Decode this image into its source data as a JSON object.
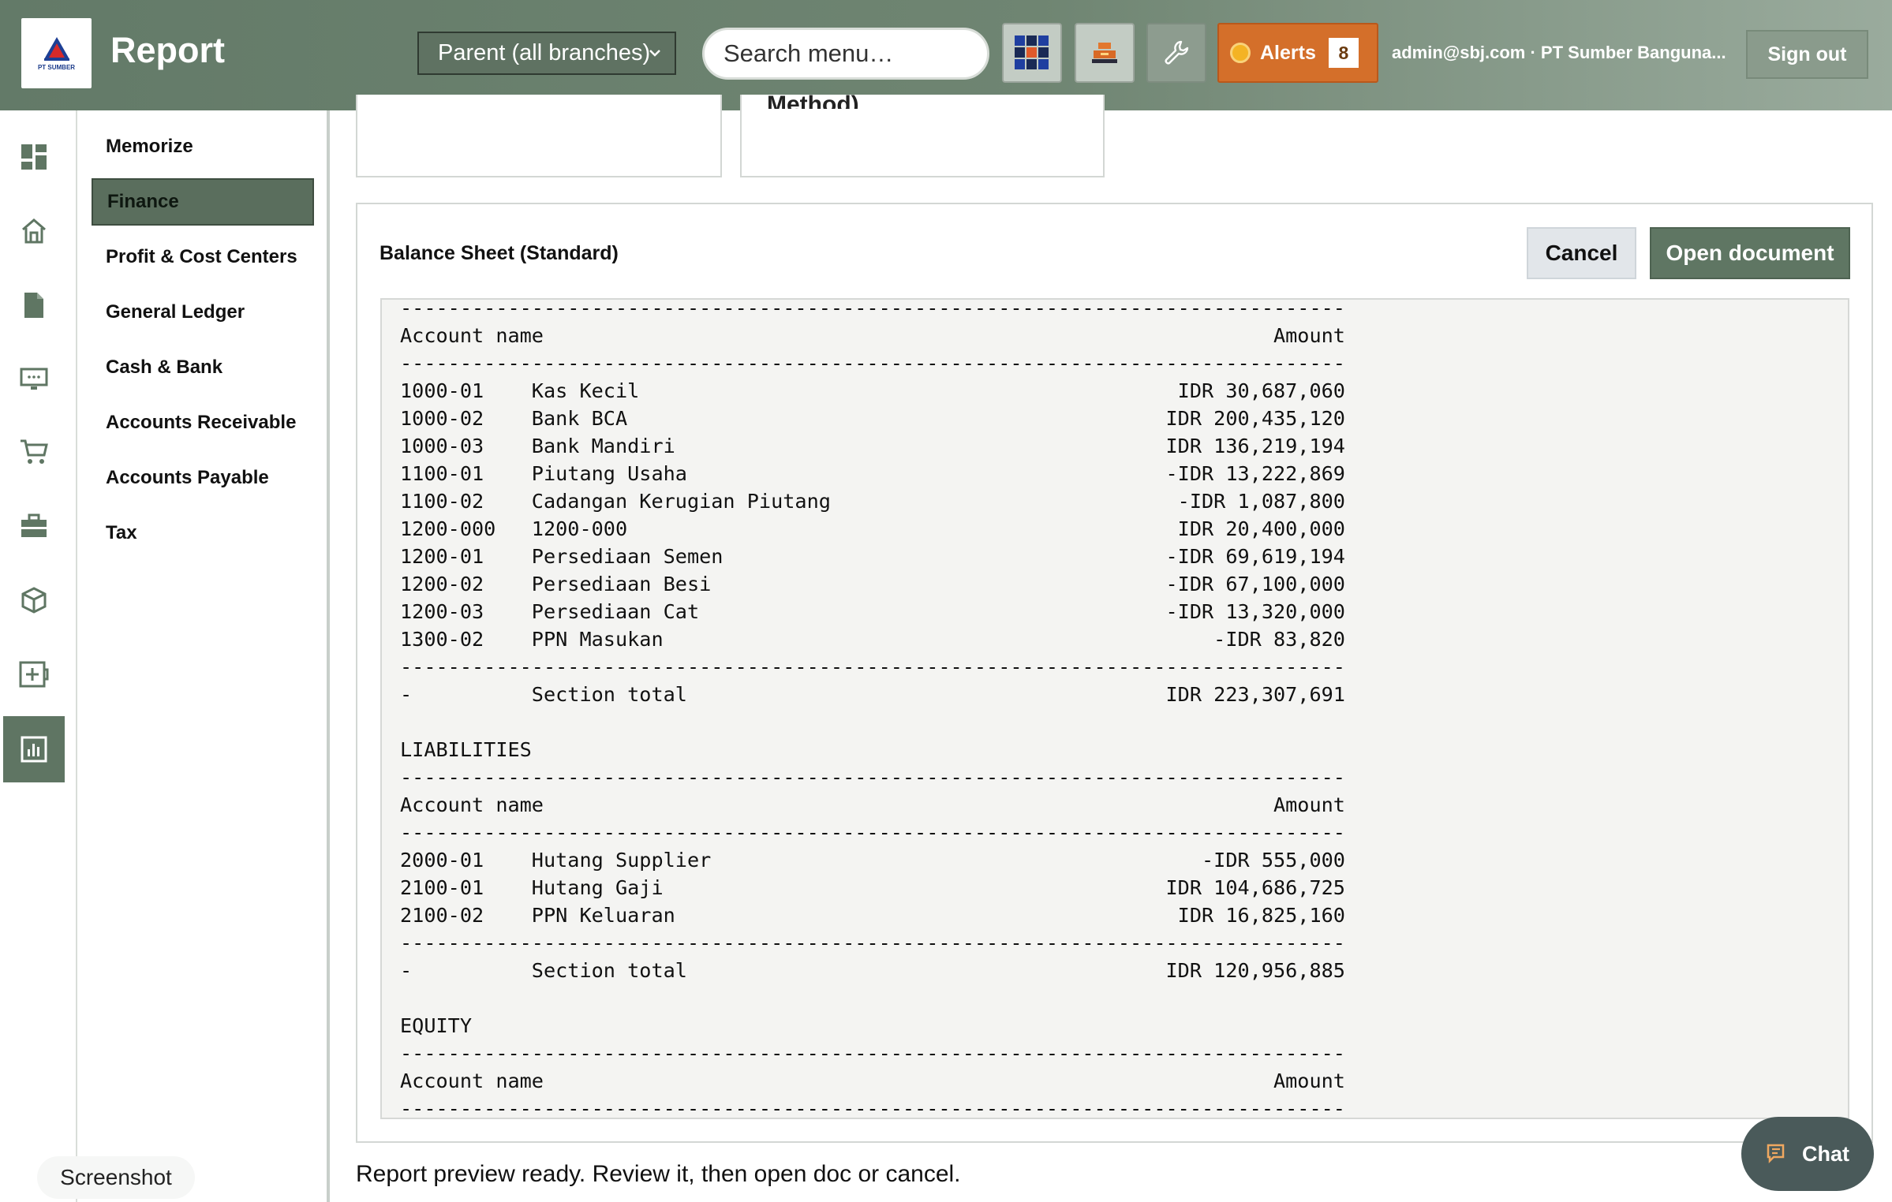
{
  "header": {
    "logo_text": "PT SUMBER",
    "title": "Report",
    "branch_select": "Parent (all branches)",
    "search_placeholder": "Search menu…",
    "alerts_label": "Alerts",
    "alerts_count": "8",
    "user": "admin@sbj.com · PT Sumber Banguna...",
    "sign_out": "Sign out"
  },
  "rail": {
    "icons": [
      "dashboard-icon",
      "home-icon",
      "document-icon",
      "monitor-icon",
      "cart-icon",
      "briefcase-icon",
      "box-icon",
      "add-box-icon",
      "report-icon"
    ],
    "active": "report-icon"
  },
  "subnav": {
    "items": [
      {
        "label": "Memorize"
      },
      {
        "label": "Finance"
      },
      {
        "label": "Profit & Cost Centers"
      },
      {
        "label": "General Ledger"
      },
      {
        "label": "Cash & Bank"
      },
      {
        "label": "Accounts Receivable"
      },
      {
        "label": "Accounts Payable"
      },
      {
        "label": "Tax"
      }
    ],
    "active": "Finance"
  },
  "cards_top": [
    {
      "text": ""
    },
    {
      "text": "Method)"
    }
  ],
  "panel": {
    "title": "Balance Sheet (Standard)",
    "cancel_label": "Cancel",
    "open_label": "Open document"
  },
  "report": {
    "col_account": "Account name",
    "col_amount": "Amount",
    "assets": [
      {
        "code": "1000-01",
        "name": "Kas Kecil",
        "amount": "IDR 30,687,060"
      },
      {
        "code": "1000-02",
        "name": "Bank BCA",
        "amount": "IDR 200,435,120"
      },
      {
        "code": "1000-03",
        "name": "Bank Mandiri",
        "amount": "IDR 136,219,194"
      },
      {
        "code": "1100-01",
        "name": "Piutang Usaha",
        "amount": "-IDR 13,222,869"
      },
      {
        "code": "1100-02",
        "name": "Cadangan Kerugian Piutang",
        "amount": "-IDR 1,087,800"
      },
      {
        "code": "1200-000",
        "name": "1200-000",
        "amount": "IDR 20,400,000"
      },
      {
        "code": "1200-01",
        "name": "Persediaan Semen",
        "amount": "-IDR 69,619,194"
      },
      {
        "code": "1200-02",
        "name": "Persediaan Besi",
        "amount": "-IDR 67,100,000"
      },
      {
        "code": "1200-03",
        "name": "Persediaan Cat",
        "amount": "-IDR 13,320,000"
      },
      {
        "code": "1300-02",
        "name": "PPN Masukan",
        "amount": "-IDR 83,820"
      }
    ],
    "assets_total": {
      "code": "-",
      "name": "Section total",
      "amount": "IDR 223,307,691"
    },
    "liabilities_heading": "LIABILITIES",
    "liabilities": [
      {
        "code": "2000-01",
        "name": "Hutang Supplier",
        "amount": "-IDR 555,000"
      },
      {
        "code": "2100-01",
        "name": "Hutang Gaji",
        "amount": "IDR 104,686,725"
      },
      {
        "code": "2100-02",
        "name": "PPN Keluaran",
        "amount": "IDR 16,825,160"
      }
    ],
    "liabilities_total": {
      "code": "-",
      "name": "Section total",
      "amount": "IDR 120,956,885"
    },
    "equity_heading": "EQUITY"
  },
  "status_text": "Report preview ready. Review it, then open doc or cancel.",
  "screenshot_label": "Screenshot",
  "chat_label": "Chat",
  "colors": {
    "header_green": "#637a68",
    "accent_green": "#5f7663",
    "alerts_orange": "#d46f2a"
  }
}
